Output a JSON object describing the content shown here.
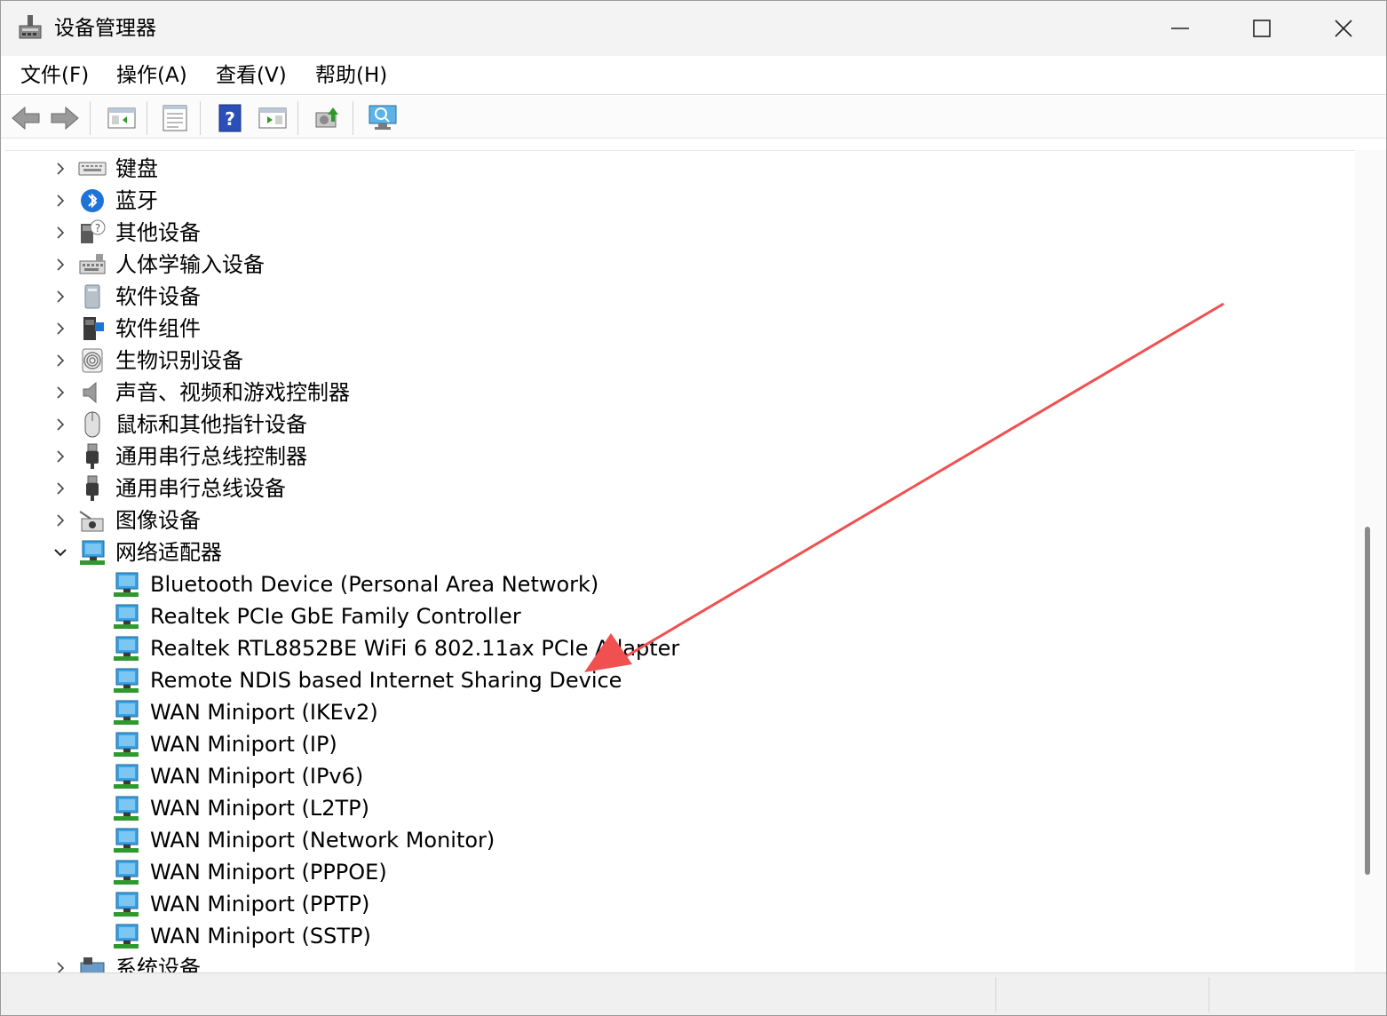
{
  "window": {
    "title": "设备管理器",
    "controls": {
      "minimize": "minimize",
      "maximize": "maximize",
      "close": "close"
    }
  },
  "menu": [
    {
      "label": "文件(F)"
    },
    {
      "label": "操作(A)"
    },
    {
      "label": "查看(V)"
    },
    {
      "label": "帮助(H)"
    }
  ],
  "toolbar": {
    "buttons": [
      "back-arrow-icon",
      "forward-arrow-icon",
      "properties-panel-icon",
      "view-list-icon",
      "help-icon",
      "run-view-icon",
      "update-driver-icon",
      "scan-hardware-icon"
    ]
  },
  "tree": {
    "categories": [
      {
        "label": "键盘",
        "icon": "keyboard-icon",
        "expanded": false
      },
      {
        "label": "蓝牙",
        "icon": "bluetooth-icon",
        "expanded": false
      },
      {
        "label": "其他设备",
        "icon": "unknown-device-icon",
        "expanded": false
      },
      {
        "label": "人体学输入设备",
        "icon": "hid-icon",
        "expanded": false
      },
      {
        "label": "软件设备",
        "icon": "software-device-icon",
        "expanded": false
      },
      {
        "label": "软件组件",
        "icon": "software-component-icon",
        "expanded": false
      },
      {
        "label": "生物识别设备",
        "icon": "fingerprint-icon",
        "expanded": false
      },
      {
        "label": "声音、视频和游戏控制器",
        "icon": "speaker-icon",
        "expanded": false
      },
      {
        "label": "鼠标和其他指针设备",
        "icon": "mouse-icon",
        "expanded": false
      },
      {
        "label": "通用串行总线控制器",
        "icon": "usb-icon",
        "expanded": false
      },
      {
        "label": "通用串行总线设备",
        "icon": "usb-icon",
        "expanded": false
      },
      {
        "label": "图像设备",
        "icon": "camera-icon",
        "expanded": false
      },
      {
        "label": "网络适配器",
        "icon": "network-adapter-icon",
        "expanded": true
      }
    ],
    "network_adapters": [
      "Bluetooth Device (Personal Area Network)",
      "Realtek PCIe GbE Family Controller",
      "Realtek RTL8852BE WiFi 6 802.11ax PCIe Adapter",
      "Remote NDIS based Internet Sharing Device",
      "WAN Miniport (IKEv2)",
      "WAN Miniport (IP)",
      "WAN Miniport (IPv6)",
      "WAN Miniport (L2TP)",
      "WAN Miniport (Network Monitor)",
      "WAN Miniport (PPPOE)",
      "WAN Miniport (PPTP)",
      "WAN Miniport (SSTP)"
    ],
    "trailing_category": {
      "label": "系统设备",
      "icon": "system-device-icon",
      "expanded": false
    }
  },
  "annotation": {
    "type": "arrow",
    "color": "#f05050"
  }
}
